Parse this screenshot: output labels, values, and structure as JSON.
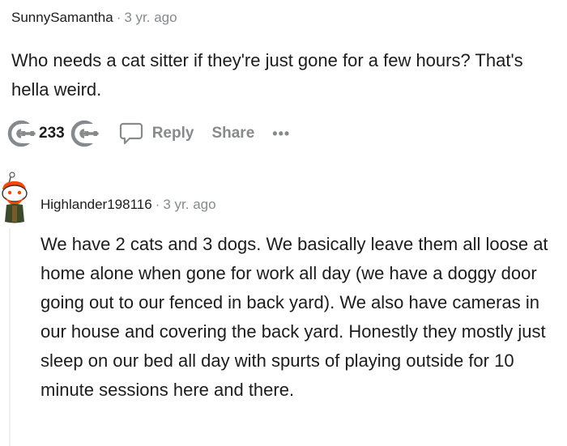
{
  "comments": [
    {
      "username": "SunnySamantha",
      "separator": "·",
      "timestamp": "3 yr. ago",
      "body": "Who needs a cat sitter if they're just gone for a few hours? That's hella weird.",
      "score": "233",
      "reply_label": "Reply",
      "share_label": "Share",
      "more_label": "•••"
    },
    {
      "username": "Highlander198116",
      "separator": "·",
      "timestamp": "3 yr. ago",
      "body": "We have 2 cats and 3 dogs. We basically leave them all loose at home alone when gone for work all day (we have a doggy door going out to our fenced in back yard). We also have cameras in our house and covering the back yard. Honestly they mostly just sleep on our bed all day with spurts of playing outside for 10 minute sessions here and there."
    }
  ],
  "icons": {
    "upvote": "upvote-icon",
    "downvote": "downvote-icon",
    "reply": "speech-bubble-icon",
    "avatar": "snoo-avatar"
  },
  "colors": {
    "text": "#1c1c1c",
    "muted": "#878a8c",
    "thread_line": "#edeff1",
    "avatar_accent": "#ff4500"
  }
}
